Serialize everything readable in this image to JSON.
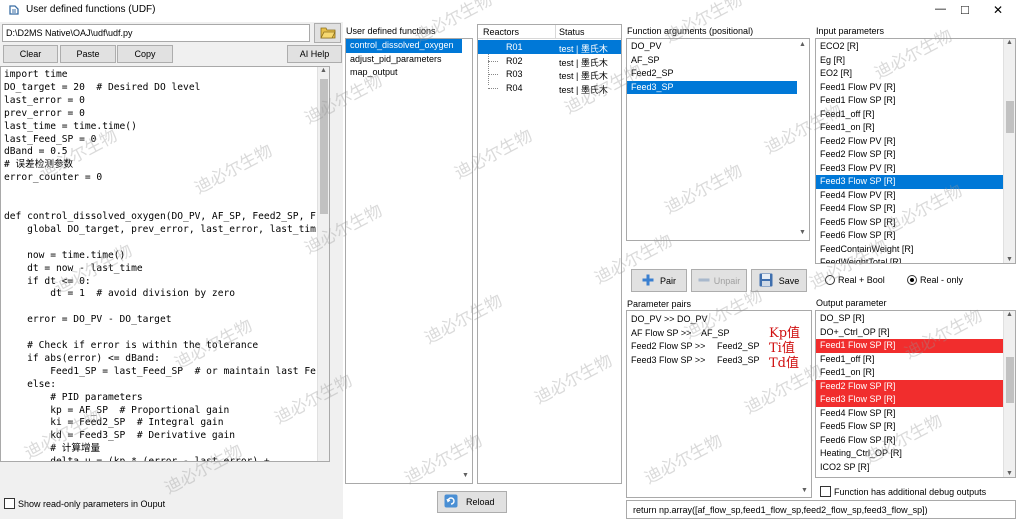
{
  "window": {
    "title": "User defined functions (UDF)",
    "minimize": "—",
    "maximize": "□",
    "close": "✕"
  },
  "file": {
    "path": "D:\\D2MS Native\\OAJ\\udf\\udf.py"
  },
  "toolbar": {
    "clear": "Clear",
    "paste": "Paste",
    "copy": "Copy",
    "ai_help": "AI Help"
  },
  "code_text": "import time\nDO_target = 20  # Desired DO level\nlast_error = 0\nprev_error = 0\nlast_time = time.time()\nlast_Feed_SP = 0\ndBand = 0.5\n# 误差检测参数\nerror_counter = 0\n\n\ndef control_dissolved_oxygen(DO_PV, AF_SP, Feed2_SP, F\n    global DO_target, prev_error, last_error, last_tim\n\n    now = time.time()\n    dt = now - last_time\n    if dt <= 0:\n        dt = 1  # avoid division by zero\n\n    error = DO_PV - DO_target\n\n    # Check if error is within the tolerance\n    if abs(error) <= dBand:\n        Feed1_SP = last_Feed_SP  # or maintain last Fe\n    else:\n        # PID parameters\n        kp = AF_SP  # Proportional gain\n        ki = Feed2_SP  # Integral gain\n        kd = Feed3_SP  # Derivative gain\n        # 计算增量\n        delta_u = (kp * (error - last_error) +",
  "show_readonly": "Show read-only parameters in Ouput",
  "udf": {
    "header": "User defined functions",
    "items": [
      "control_dissolved_oxygen",
      "adjust_pid_parameters",
      "map_output"
    ],
    "selected": 0
  },
  "reactors": {
    "col_reactors": "Reactors",
    "col_status": "Status",
    "rows": [
      {
        "name": "R01",
        "status": "test | 墨氏木"
      },
      {
        "name": "R02",
        "status": "test | 墨氏木"
      },
      {
        "name": "R03",
        "status": "test | 墨氏木"
      },
      {
        "name": "R04",
        "status": "test | 墨氏木"
      }
    ]
  },
  "reload": "Reload",
  "func_args": {
    "header": "Function arguments (positional)",
    "items": [
      "DO_PV",
      "AF_SP",
      "Feed2_SP",
      "Feed3_SP"
    ],
    "selected": 3
  },
  "pair_buttons": {
    "pair": "Pair",
    "unpair": "Unpair",
    "save": "Save"
  },
  "radio": {
    "real_bool": "Real + Bool",
    "real_only": "Real - only",
    "selected": "real_only"
  },
  "param_pairs": {
    "header": "Parameter pairs",
    "items": [
      {
        "left": "DO_PV >> DO_PV",
        "right": ""
      },
      {
        "left": "AF Flow SP >>",
        "right": "AF_SP"
      },
      {
        "left": "Feed2 Flow SP >>",
        "right": "Feed2_SP"
      },
      {
        "left": "Feed3 Flow SP >>",
        "right": "Feed3_SP"
      }
    ],
    "annotations": [
      "Kp值",
      "Ti值",
      "Td值"
    ]
  },
  "return_line": "return np.array([af_flow_sp,feed1_flow_sp,feed2_flow_sp,feed3_flow_sp])",
  "input_params": {
    "header": "Input parameters",
    "items": [
      "ECO2 [R]",
      "Eg [R]",
      "EO2 [R]",
      "Feed1 Flow PV [R]",
      "Feed1 Flow SP [R]",
      "Feed1_off [R]",
      "Feed1_on [R]",
      "Feed2 Flow PV [R]",
      "Feed2 Flow SP [R]",
      "Feed3 Flow PV [R]",
      "Feed3 Flow SP [R]",
      "Feed4 Flow PV [R]",
      "Feed4 Flow SP [R]",
      "Feed5 Flow SP [R]",
      "Feed6 Flow SP [R]",
      "FeedContainWeight [R]",
      "FeedWeightTotal [R]"
    ],
    "selected": 10
  },
  "output_params": {
    "header": "Output parameter",
    "items": [
      "DO_SP [R]",
      "DO+_Ctrl_OP [R]",
      "Feed1 Flow SP [R]",
      "Feed1_off [R]",
      "Feed1_on [R]",
      "Feed2 Flow SP [R]",
      "Feed3 Flow SP [R]",
      "Feed4 Flow SP [R]",
      "Feed5 Flow SP [R]",
      "Feed6 Flow SP [R]",
      "Heating_Ctrl_OP [R]",
      "ICO2 SP [R]"
    ],
    "highlighted": [
      2,
      5,
      6
    ]
  },
  "debug_outputs": "Function has additional debug outputs",
  "watermark": "迪必尔生物",
  "icons": {
    "app": "udf-app-icon",
    "folder": "folder-open-icon",
    "pair": "plus-icon",
    "unpair": "minus-icon",
    "save": "save-icon",
    "reload": "reload-icon"
  }
}
